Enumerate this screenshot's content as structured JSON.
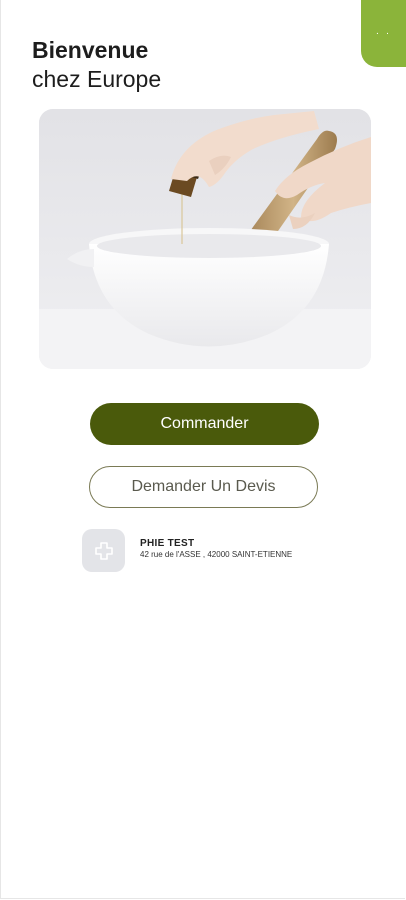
{
  "header": {
    "menu_dots": "· ·",
    "welcome_line1": "Bienvenue",
    "welcome_line2": "chez Europe"
  },
  "hero": {
    "image_description": "mortar-and-pestle-with-oil-dropper"
  },
  "actions": {
    "order_label": "Commander",
    "quote_label": "Demander Un Devis"
  },
  "pharmacy": {
    "name": "PHIE TEST",
    "address": "42 rue de l'ASSE , 42000 SAINT-ETIENNE",
    "logo_icon": "pharmacy-cross-icon"
  },
  "colors": {
    "accent": "#8bb43a",
    "primary": "#4a5a0b",
    "outline": "#7a7a55"
  }
}
